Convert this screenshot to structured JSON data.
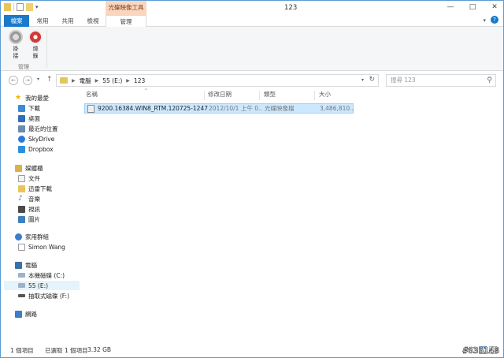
{
  "window": {
    "title": "123",
    "context_tab_header": "光碟映像工具"
  },
  "ribbon": {
    "tabs": {
      "file": "檔案",
      "home": "常用",
      "share": "共用",
      "view": "檢視",
      "manage": "管理"
    },
    "buttons": {
      "mount": "掛接",
      "burn": "燒錄"
    },
    "group_label": "管理"
  },
  "address": {
    "crumbs": [
      "電腦",
      "55 (E:)",
      "123"
    ],
    "search_placeholder": "搜尋 123"
  },
  "nav": {
    "favorites": {
      "header": "我的最愛",
      "items": [
        "下載",
        "桌面",
        "最近的位置",
        "SkyDrive",
        "Dropbox"
      ]
    },
    "libraries": {
      "header": "媒體櫃",
      "items": [
        "文件",
        "迅雷下載",
        "音樂",
        "視訊",
        "圖片"
      ]
    },
    "homegroup": {
      "header": "家用群組",
      "items": [
        "Simon Wang"
      ]
    },
    "computer": {
      "header": "電腦",
      "items": [
        "本機磁碟 (C:)",
        "55 (E:)",
        "抽取式磁碟 (F:)"
      ]
    },
    "network": {
      "header": "網路"
    }
  },
  "columns": {
    "name": "名稱",
    "date": "修改日期",
    "type": "類型",
    "size": "大小"
  },
  "files": [
    {
      "name": "9200.16384.WIN8_RTM.120725-1247_...",
      "date": "2012/10/1 上午 0...",
      "type": "光碟映像檔",
      "size": "3,486,810..."
    }
  ],
  "status": {
    "count": "1 個項目",
    "selected": "已選取 1 個項目",
    "size": "3.32 GB"
  },
  "watermark": "#636148",
  "colors": {
    "file_tab": "#1979ca",
    "context_header": "#f9d6bf",
    "selection": "#cce8ff"
  }
}
